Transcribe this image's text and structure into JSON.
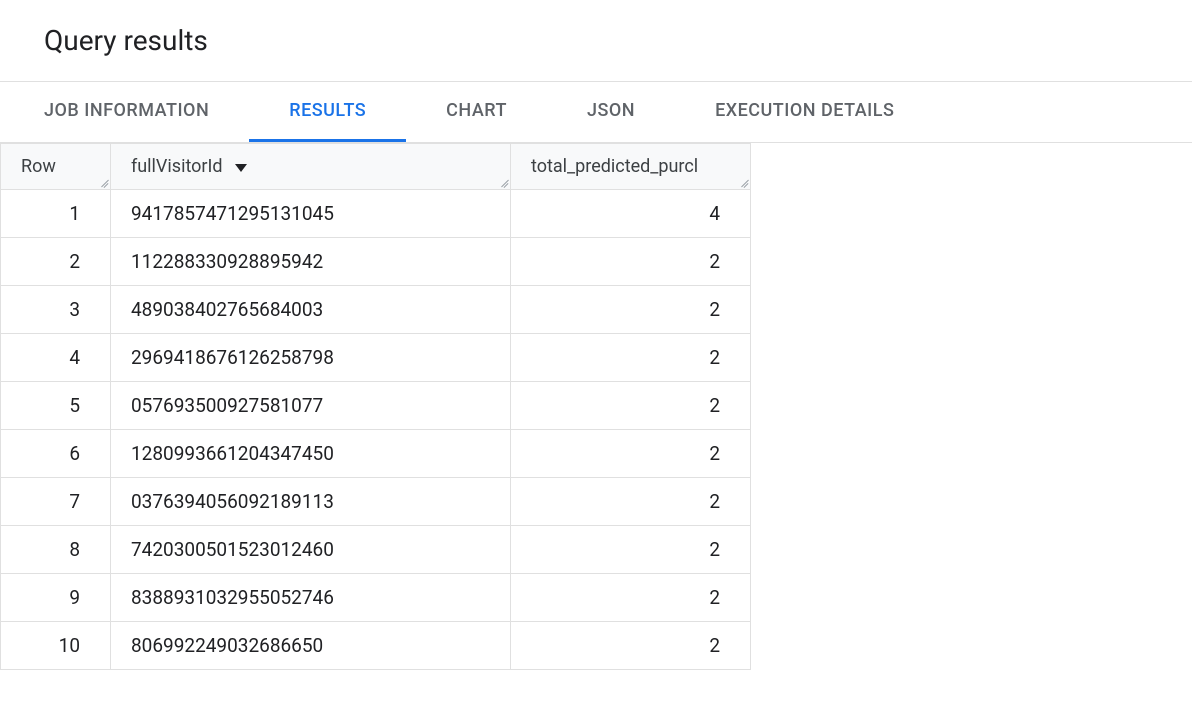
{
  "title": "Query results",
  "tabs": [
    {
      "label": "JOB INFORMATION",
      "active": false
    },
    {
      "label": "RESULTS",
      "active": true
    },
    {
      "label": "CHART",
      "active": false
    },
    {
      "label": "JSON",
      "active": false
    },
    {
      "label": "EXECUTION DETAILS",
      "active": false
    }
  ],
  "columns": {
    "row": "Row",
    "fullVisitorId": "fullVisitorId",
    "total_predicted_purchases": "total_predicted_purcl"
  },
  "sort_column": "fullVisitorId",
  "rows": [
    {
      "n": "1",
      "fullVisitorId": "9417857471295131045",
      "total_predicted_purchases": "4"
    },
    {
      "n": "2",
      "fullVisitorId": "112288330928895942",
      "total_predicted_purchases": "2"
    },
    {
      "n": "3",
      "fullVisitorId": "489038402765684003",
      "total_predicted_purchases": "2"
    },
    {
      "n": "4",
      "fullVisitorId": "2969418676126258798",
      "total_predicted_purchases": "2"
    },
    {
      "n": "5",
      "fullVisitorId": "057693500927581077",
      "total_predicted_purchases": "2"
    },
    {
      "n": "6",
      "fullVisitorId": "1280993661204347450",
      "total_predicted_purchases": "2"
    },
    {
      "n": "7",
      "fullVisitorId": "0376394056092189113",
      "total_predicted_purchases": "2"
    },
    {
      "n": "8",
      "fullVisitorId": "7420300501523012460",
      "total_predicted_purchases": "2"
    },
    {
      "n": "9",
      "fullVisitorId": "8388931032955052746",
      "total_predicted_purchases": "2"
    },
    {
      "n": "10",
      "fullVisitorId": "806992249032686650",
      "total_predicted_purchases": "2"
    }
  ]
}
